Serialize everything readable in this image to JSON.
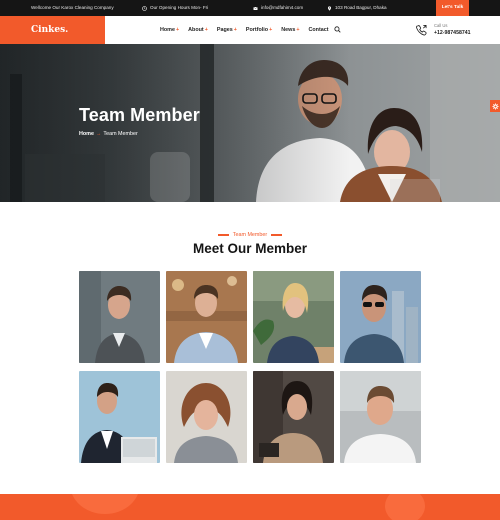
{
  "topbar": {
    "welcome": "Wellcome Our Karox Cleaning Company",
    "hours": "Our Opening Hours Mon- Fri",
    "email": "info@mdfahim4.com",
    "address": "103 Road Bagpur, Dhaka",
    "cta_label": "Let's Talk"
  },
  "nav": {
    "logo": "Cinkes.",
    "menu": [
      {
        "label": "Home",
        "has_submenu": true
      },
      {
        "label": "About",
        "has_submenu": true
      },
      {
        "label": "Pages",
        "has_submenu": true
      },
      {
        "label": "Portfolio",
        "has_submenu": true
      },
      {
        "label": "News",
        "has_submenu": true
      },
      {
        "label": "Contact",
        "has_submenu": false
      }
    ],
    "submenu_marker": "+",
    "call_label": "Call Us",
    "call_number": "+12-987458741"
  },
  "hero": {
    "title": "Team Member",
    "breadcrumb_home": "Home",
    "breadcrumb_sep": "→",
    "breadcrumb_current": "Team Member"
  },
  "section": {
    "subtitle": "Team Member",
    "title": "Meet Our Member"
  },
  "team": [
    {
      "photo": "man-grey-suit-portrait",
      "bg": "#6f7a80"
    },
    {
      "photo": "man-blue-blazer-smiling",
      "bg": "#a7764e"
    },
    {
      "photo": "woman-blonde-phone-laptop",
      "bg": "#71836c"
    },
    {
      "photo": "man-sunglasses-smiling",
      "bg": "#8aa7c2"
    },
    {
      "photo": "man-suit-laptop-desk",
      "bg": "#9cc2d7"
    },
    {
      "photo": "woman-curly-hair-portrait",
      "bg": "#d9d6d0"
    },
    {
      "photo": "woman-laughing-tablet",
      "bg": "#524a45"
    },
    {
      "photo": "man-white-tshirt-smiling",
      "bg": "#b8bcbe"
    }
  ],
  "colors": {
    "accent": "#f25a2b",
    "topbar_bg": "#151515"
  }
}
